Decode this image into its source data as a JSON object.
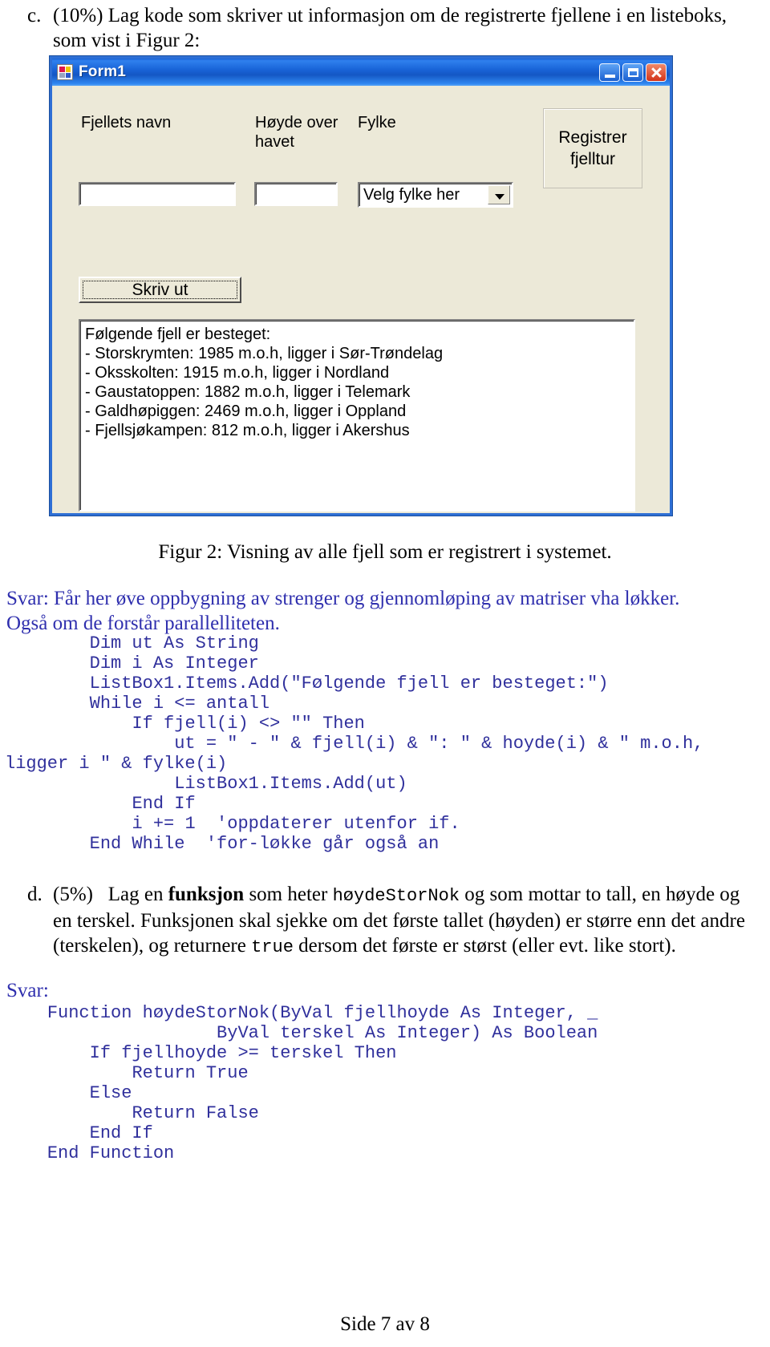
{
  "question_c": {
    "label": "c.",
    "percent": "(10%)",
    "text": "Lag kode som skriver ut informasjon om de registrerte fjellene i en listeboks, som vist i Figur 2:"
  },
  "form": {
    "title": "Form1",
    "window_icon": "app-icon",
    "caption_buttons": {
      "minimize": "minimize-icon",
      "maximize": "maximize-icon",
      "close": "close-icon"
    },
    "labels": {
      "name": "Fjellets navn",
      "height": "Høyde over havet",
      "county": "Fylke"
    },
    "inputs": {
      "name_value": "",
      "height_value": "",
      "county_selected": "Velg fylke her"
    },
    "register_panel": "Registrer fjelltur",
    "print_button": "Skriv ut",
    "listbox": {
      "items": [
        "Følgende fjell er besteget:",
        "- Storskrymten: 1985 m.o.h, ligger i Sør-Trøndelag",
        "- Oksskolten: 1915 m.o.h, ligger i Nordland",
        "- Gaustatoppen: 1882 m.o.h, ligger i Telemark",
        "- Galdhøpiggen: 2469 m.o.h, ligger i Oppland",
        "- Fjellsjøkampen: 812 m.o.h, ligger i Akershus"
      ]
    }
  },
  "figure_caption": "Figur 2: Visning av alle fjell som er registrert i systemet.",
  "answer_c": {
    "prose_line1": "Svar: Får her øve oppbygning av strenger og gjennomløping av matriser vha løkker.",
    "prose_line2": "Også om de forstår parallelliteten.",
    "code": "        Dim ut As String\n        Dim i As Integer\n        ListBox1.Items.Add(\"Følgende fjell er besteget:\")\n        While i <= antall\n            If fjell(i) <> \"\" Then\n                ut = \" - \" & fjell(i) & \": \" & hoyde(i) & \" m.o.h,\nligger i \" & fylke(i)\n                ListBox1.Items.Add(ut)\n            End If\n            i += 1  'oppdaterer utenfor if.\n        End While  'for-løkke går også an"
  },
  "question_d": {
    "label": "d.",
    "percent": "(5%)",
    "text_part1": "Lag en ",
    "bold_word": "funksjon",
    "text_part2": " som heter ",
    "mono_word1": "høydeStorNok",
    "text_part3": " og som mottar to tall, en høyde og en terskel. Funksjonen skal sjekke om det første tallet (høyden) er større enn det andre (terskelen), og returnere ",
    "mono_word2": "true",
    "text_part4": " dersom det første er størst (eller evt. like stort)."
  },
  "answer_d": {
    "svar_label": "Svar:",
    "code": "    Function høydeStorNok(ByVal fjellhoyde As Integer, _\n                    ByVal terskel As Integer) As Boolean\n        If fjellhoyde >= terskel Then\n            Return True\n        Else\n            Return False\n        End If\n    End Function"
  },
  "footer": "Side 7 av 8",
  "colors": {
    "answer_blue": "#2f2fae",
    "code_blue": "#30309c",
    "titlebar_blue": "#1964d8",
    "form_face": "#ece9d8"
  }
}
